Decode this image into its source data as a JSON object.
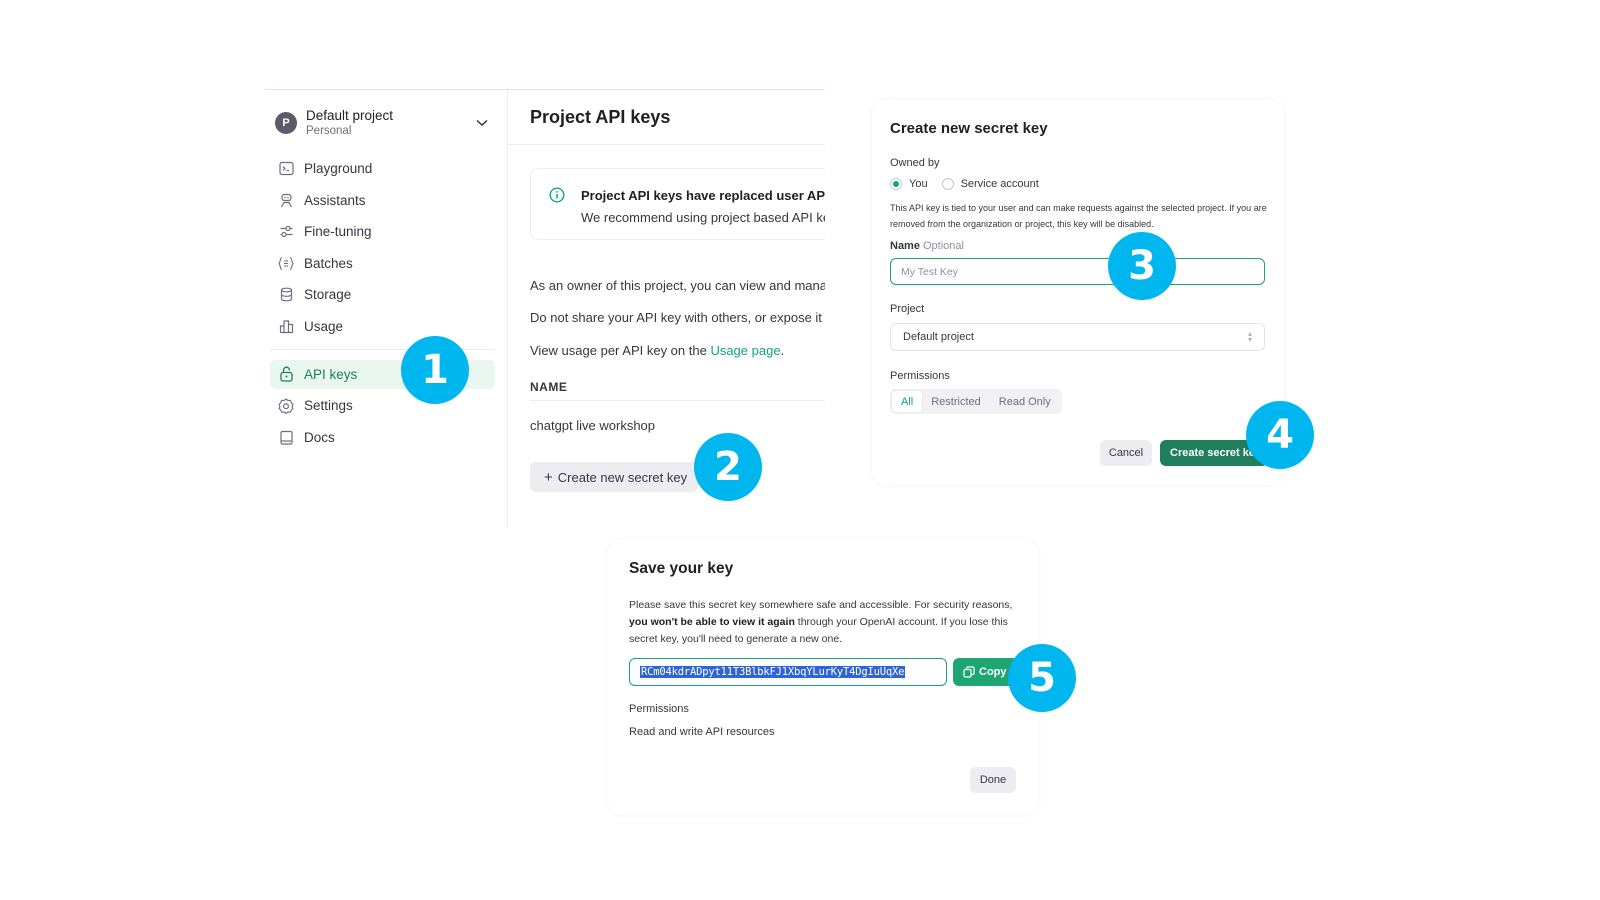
{
  "sidebar": {
    "project": {
      "avatar_letter": "P",
      "name": "Default project",
      "subtitle": "Personal"
    },
    "items": [
      {
        "label": "Playground",
        "icon": "terminal-icon"
      },
      {
        "label": "Assistants",
        "icon": "robot-icon"
      },
      {
        "label": "Fine-tuning",
        "icon": "sliders-icon"
      },
      {
        "label": "Batches",
        "icon": "braces-list-icon"
      },
      {
        "label": "Storage",
        "icon": "database-icon"
      },
      {
        "label": "Usage",
        "icon": "bar-chart-icon"
      },
      {
        "label": "API keys",
        "icon": "lock-icon",
        "active": true
      },
      {
        "label": "Settings",
        "icon": "gear-icon"
      },
      {
        "label": "Docs",
        "icon": "book-icon"
      }
    ]
  },
  "main": {
    "title": "Project API keys",
    "notice": {
      "title": "Project API keys have replaced user API keys.",
      "body": "We recommend using project based API keys for more granular control over your resources."
    },
    "paragraphs": [
      "As an owner of this project, you can view and manage all API keys in this project.",
      "Do not share your API key with others, or expose it in the browser or other client-side code."
    ],
    "usage_prefix": "View usage per API key on the ",
    "usage_link": "Usage page",
    "usage_suffix": ".",
    "table": {
      "columns": [
        "NAME"
      ],
      "rows": [
        {
          "name": "chatgpt live workshop"
        }
      ]
    },
    "create_button": "Create new secret key"
  },
  "create_dialog": {
    "title": "Create new secret key",
    "owned_by_label": "Owned by",
    "owner_options": [
      {
        "label": "You",
        "selected": true
      },
      {
        "label": "Service account",
        "selected": false
      }
    ],
    "help_text": "This API key is tied to your user and can make requests against the selected project. If you are removed from the organization or project, this key will be disabled.",
    "name_label": "Name",
    "name_optional": "Optional",
    "name_placeholder": "My Test Key",
    "name_value": "",
    "project_label": "Project",
    "project_value": "Default project",
    "permissions_label": "Permissions",
    "permission_options": [
      {
        "label": "All",
        "selected": true
      },
      {
        "label": "Restricted",
        "selected": false
      },
      {
        "label": "Read Only",
        "selected": false
      }
    ],
    "cancel_label": "Cancel",
    "submit_label": "Create secret key"
  },
  "save_dialog": {
    "title": "Save your key",
    "desc_part1": "Please save this secret key somewhere safe and accessible. For security reasons, ",
    "desc_bold": "you won't be able to view it again",
    "desc_part2": " through your OpenAI account. If you lose this secret key, you'll need to generate a new one.",
    "key_value": "RCm04kdrADpyt11T3BlbkFJ1XbqYLurKyT4DgIuUqXe",
    "copy_label": "Copy",
    "permissions_label": "Permissions",
    "permissions_value": "Read and write API resources",
    "done_label": "Done"
  },
  "steps": [
    "1",
    "2",
    "3",
    "4",
    "5"
  ],
  "colors": {
    "accent_green": "#10a37f",
    "button_green": "#1f7e5b",
    "badge_blue": "#00b6ef",
    "active_nav_bg": "#eaf7ee",
    "key_highlight": "#2f63d6"
  }
}
